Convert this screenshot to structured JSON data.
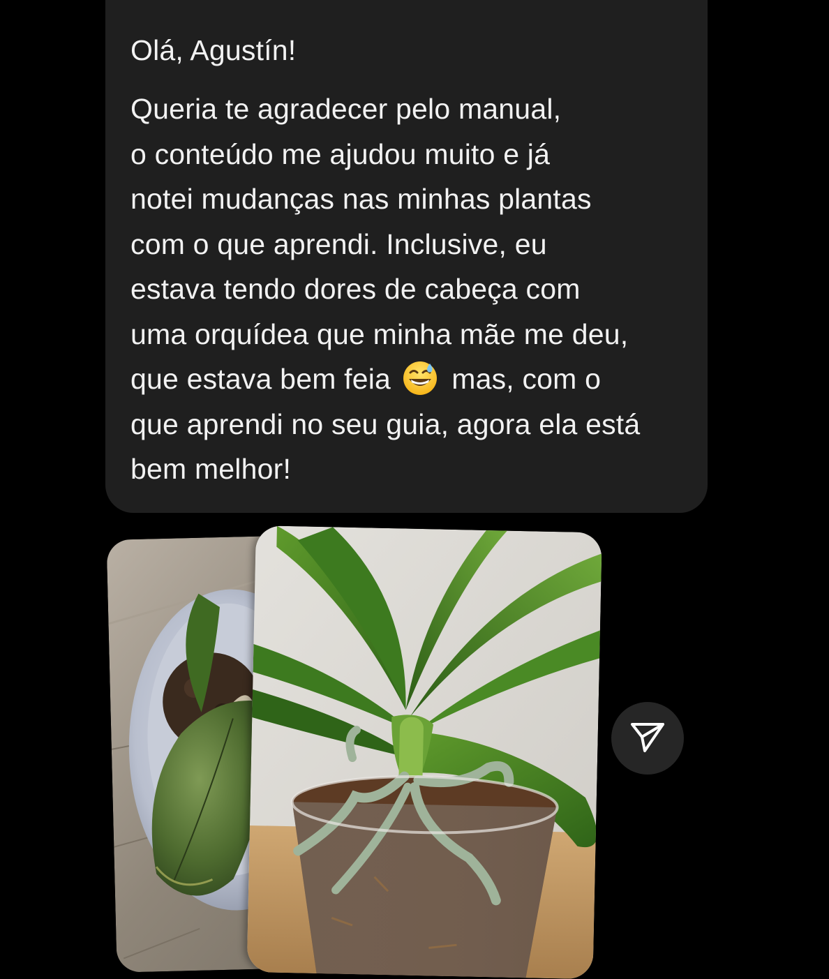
{
  "message": {
    "greeting": "Olá, Agustín!",
    "lines": [
      "Queria te  agradecer pelo manual,",
      "o conteúdo me ajudou muito e já",
      "notei mudanças nas minhas plantas",
      "com o que aprendi. Inclusive, eu",
      "estava tendo dores de cabeça com",
      "uma orquídea que minha mãe me deu,"
    ],
    "line_emoji_before": "que estava bem feia",
    "line_emoji_after": "mas, com o",
    "emoji_icon": "grinning-face-with-sweat-emoji",
    "lines_after": [
      "que aprendi no seu guia, agora ela está",
      "bem melhor!"
    ]
  },
  "attachments": {
    "photos": [
      {
        "name": "orchid-before-photo"
      },
      {
        "name": "orchid-after-photo"
      }
    ],
    "share_icon": "paper-plane-icon"
  },
  "colors": {
    "background": "#000000",
    "bubble": "#1f1f1f",
    "text": "#f2f2f2",
    "share_button": "#262626"
  }
}
